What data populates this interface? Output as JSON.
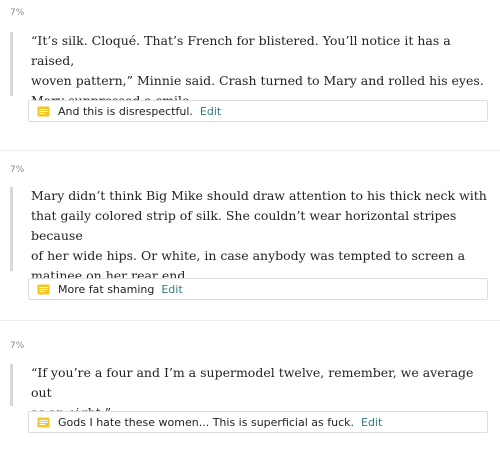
{
  "colors": {
    "accent_link": "#2f7f7e",
    "note_icon": "#f3c623",
    "quote_bar": "#d8d8d8"
  },
  "entries": [
    {
      "percent": "7%",
      "quote_lines": [
        "“It’s silk. Cloqué. That’s French for blistered. You’ll notice it has a raised,",
        "woven pattern,” Minnie said. Crash turned to Mary and rolled his eyes.",
        "Mary suppressed a smile."
      ],
      "note": {
        "icon": "note-icon",
        "text": "And this is disrespectful.",
        "edit_label": "Edit"
      }
    },
    {
      "percent": "7%",
      "quote_lines": [
        "Mary didn’t think Big Mike should draw attention to his thick neck with",
        "that gaily colored strip of silk. She couldn’t wear horizontal stripes because",
        "of her wide hips. Or white, in case anybody was tempted to screen a",
        "matinee on her rear end."
      ],
      "note": {
        "icon": "note-icon",
        "text": "More fat shaming",
        "edit_label": "Edit"
      }
    },
    {
      "percent": "7%",
      "quote_lines": [
        "“If you’re a four and I’m a supermodel twelve, remember, we average out",
        "as an eight.”"
      ],
      "note": {
        "icon": "note-icon",
        "text": "Gods I hate these women... This is superficial as fuck.",
        "edit_label": "Edit"
      }
    }
  ]
}
